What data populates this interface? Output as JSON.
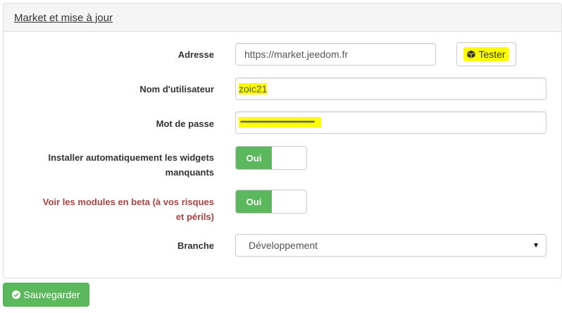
{
  "panel": {
    "title": "Market et mise à jour"
  },
  "form": {
    "address": {
      "label": "Adresse",
      "value": "https://market.jeedom.fr"
    },
    "test_button": {
      "label": "Tester",
      "icon": "cube-icon"
    },
    "username": {
      "label": "Nom d'utilisateur",
      "value": "zoic21"
    },
    "password": {
      "label": "Mot de passe",
      "value": "••••••••••••••••••••••••••••••••••••••••••"
    },
    "auto_install": {
      "label_line1": "Installer automatiquement les widgets",
      "label_line2": "manquants",
      "state": "Oui"
    },
    "beta": {
      "label_line1": "Voir les modules en beta (à vos risques",
      "label_line2": "et périls)",
      "state": "Oui"
    },
    "branch": {
      "label": "Branche",
      "selected": "Développement"
    }
  },
  "actions": {
    "save_label": "Sauvegarder",
    "save_icon": "check-circle-icon"
  },
  "colors": {
    "success": "#5cb85c",
    "highlight": "#ffff00",
    "danger_text": "#a94442"
  }
}
